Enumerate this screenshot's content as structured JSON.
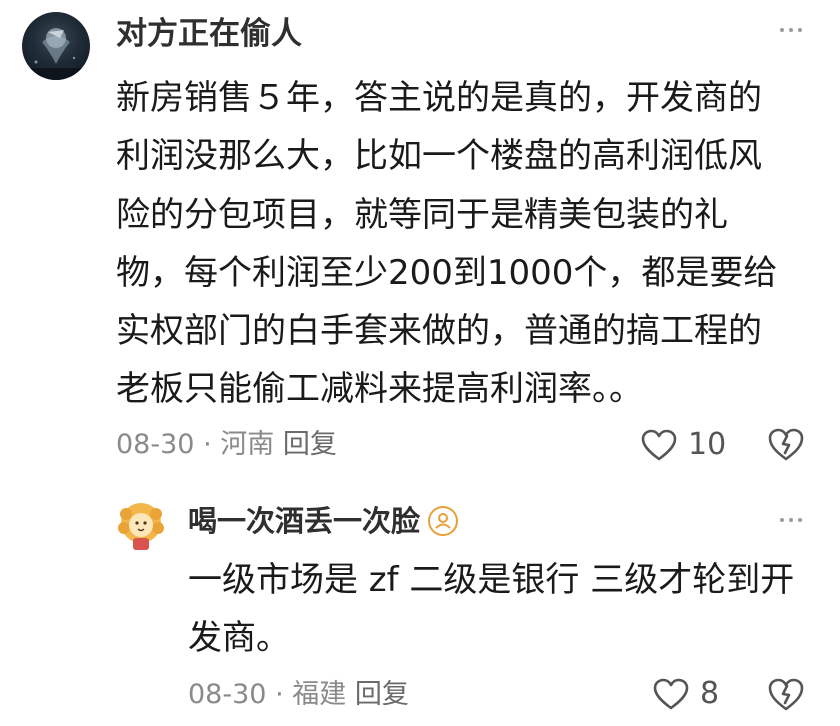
{
  "comment": {
    "author": "对方正在偷人",
    "lines": [
      "新房销售５年，答主说的是真的，开发商的",
      "利润没那么大，比如一个楼盘的高利润低风",
      "险的分包项目，就等同于是精美包装的礼",
      "物，每个利润至少200到1000个，都是要给",
      "实权部门的白手套来做的，普通的搞工程的",
      "老板只能偷工减料来提高利润率。。"
    ],
    "date": "08-30",
    "location": "河南",
    "reply_label": "回复",
    "likes": "10",
    "icons": [
      "more-icon",
      "heart-icon",
      "dislike-icon"
    ]
  },
  "reply": {
    "author": "喝一次酒丢一次脸",
    "lines": [
      "一级市场是 zf 二级是银行 三级才轮到开",
      "发商。"
    ],
    "date": "08-30",
    "location": "福建",
    "reply_label": "回复",
    "likes": "8",
    "badge_color": "#e8a03a"
  }
}
